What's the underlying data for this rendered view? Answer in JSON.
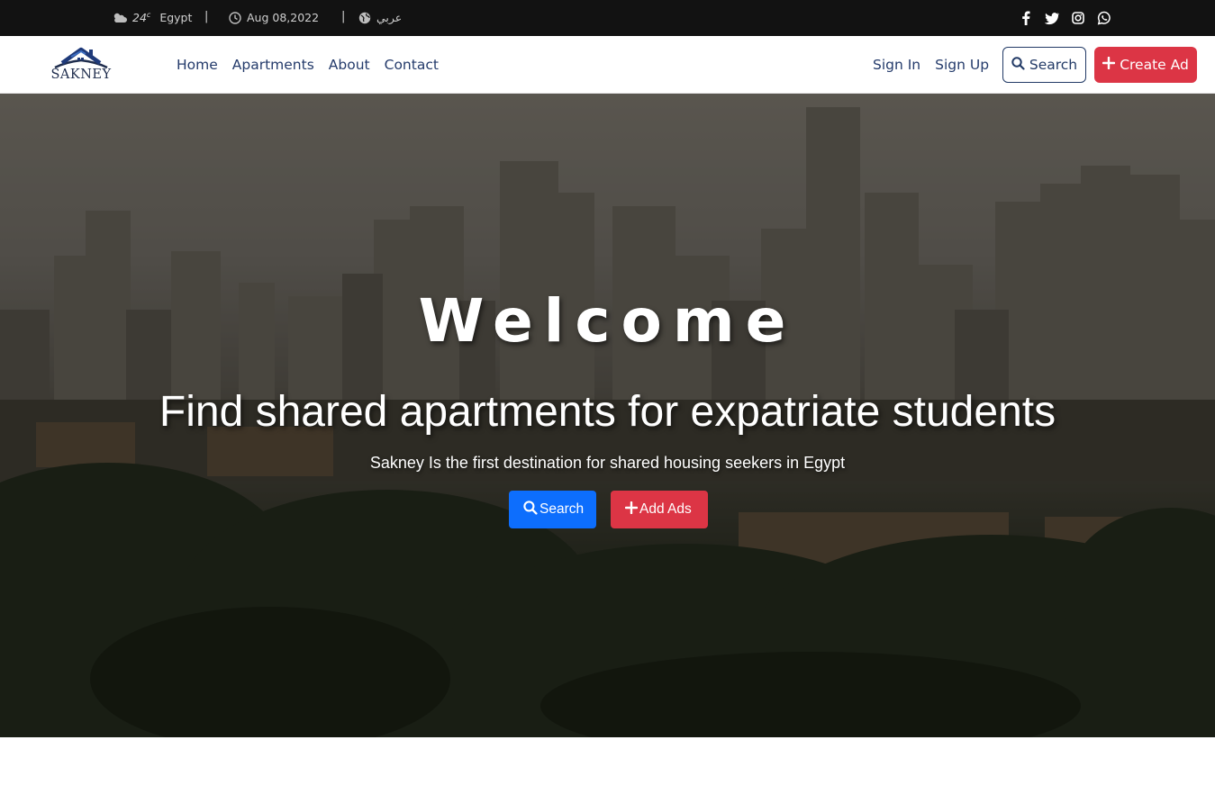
{
  "topbar": {
    "weather_icon": "cloud-sun-icon",
    "temperature": "24",
    "temperature_unit": "c",
    "location": "Egypt",
    "separator": "|",
    "clock_icon": "clock-icon",
    "date": "Aug 08,2022",
    "globe_icon": "globe-icon",
    "language": "عربي",
    "social": [
      "facebook-icon",
      "twitter-icon",
      "instagram-icon",
      "whatsapp-icon"
    ]
  },
  "navbar": {
    "logo_text": "SAKNEY",
    "links": [
      "Home",
      "Apartments",
      "About",
      "Contact"
    ],
    "sign_in": "Sign In",
    "sign_up": "Sign Up",
    "search_label": "Search",
    "create_ad_label": "Create Ad"
  },
  "hero": {
    "title": "Welcome",
    "headline": "Find shared apartments for expatriate students",
    "subline": "Sakney Is the first destination for shared housing seekers in Egypt",
    "search_button": "Search",
    "add_button": "Add Ads"
  },
  "colors": {
    "topbar_bg": "#121212",
    "brand_navy": "#223a66",
    "primary_blue": "#0d6efd",
    "danger_red": "#dc3545"
  }
}
